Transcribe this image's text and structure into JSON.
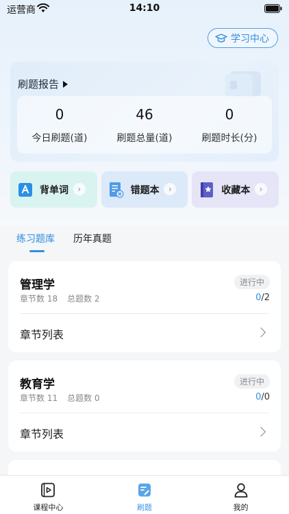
{
  "status_bar": {
    "carrier": "运营商",
    "time": "14:10"
  },
  "header": {
    "study_center_label": "学习中心"
  },
  "report": {
    "title": "刷题报告",
    "stats": [
      {
        "value": "0",
        "label": "今日刷题(道)"
      },
      {
        "value": "46",
        "label": "刷题总量(道)"
      },
      {
        "value": "0",
        "label": "刷题时长(分)"
      }
    ]
  },
  "quick_actions": [
    {
      "label": "背单词",
      "icon": "letter-a-icon"
    },
    {
      "label": "错题本",
      "icon": "wrong-notebook-icon"
    },
    {
      "label": "收藏本",
      "icon": "favorites-book-icon"
    }
  ],
  "tabs": [
    {
      "label": "练习题库",
      "active": true
    },
    {
      "label": "历年真题",
      "active": false
    }
  ],
  "subjects": [
    {
      "name": "管理学",
      "chapters_label": "章节数 18",
      "questions_label": "总题数 2",
      "status": "进行中",
      "progress_done": "0",
      "progress_total": "/2",
      "chapter_list_label": "章节列表"
    },
    {
      "name": "教育学",
      "chapters_label": "章节数 11",
      "questions_label": "总题数 0",
      "status": "进行中",
      "progress_done": "0",
      "progress_total": "/0",
      "chapter_list_label": "章节列表"
    }
  ],
  "bottom_nav": [
    {
      "label": "课程中心",
      "icon": "course-video-icon",
      "active": false
    },
    {
      "label": "刷题",
      "icon": "practice-icon",
      "active": true
    },
    {
      "label": "我的",
      "icon": "profile-icon",
      "active": false
    }
  ],
  "colors": {
    "accent": "#2f8ee0",
    "muted": "#888888"
  }
}
